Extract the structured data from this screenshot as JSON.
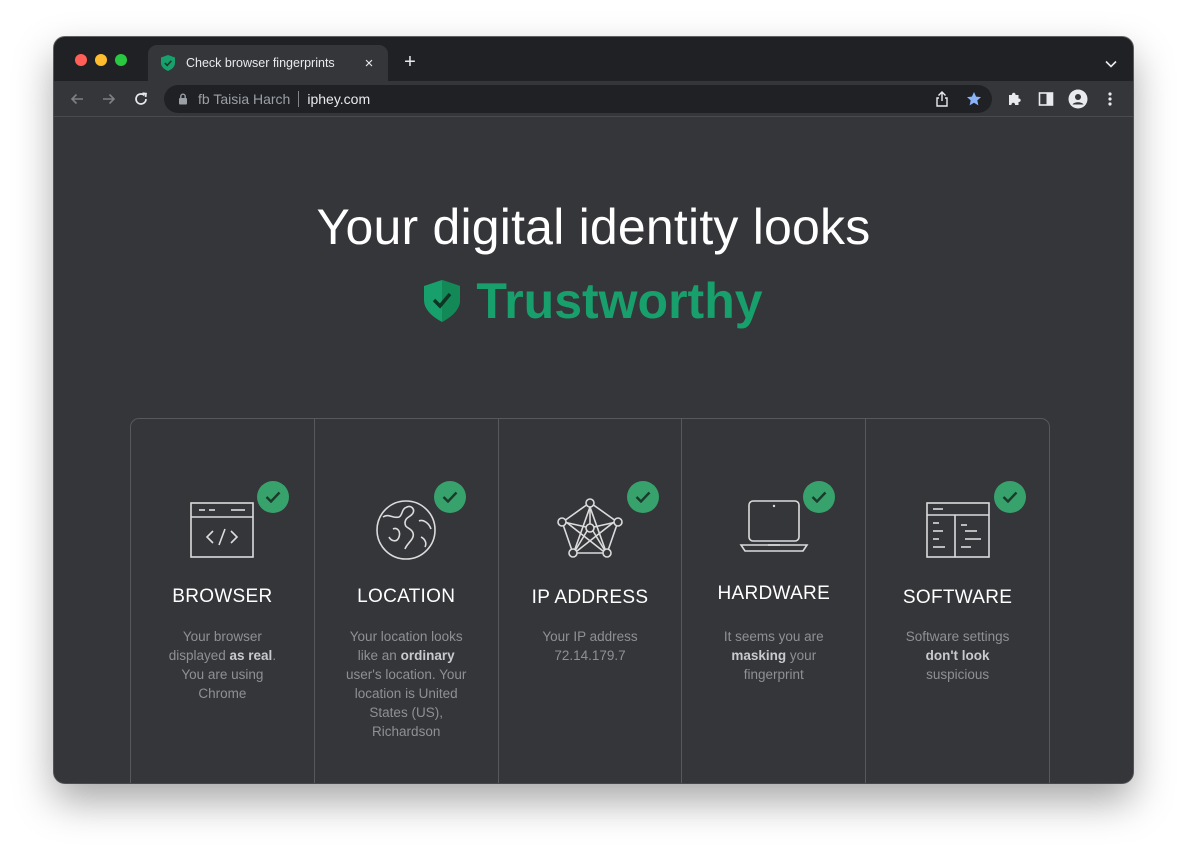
{
  "tab": {
    "title": "Check browser fingerprints",
    "close_glyph": "×",
    "new_tab_glyph": "+"
  },
  "omnibox": {
    "profile": "fb Taisia Harch",
    "url": "iphey.com"
  },
  "headline": "Your digital identity looks",
  "verdict": {
    "label": "Trustworthy",
    "color": "#17a06b"
  },
  "cards": [
    {
      "title": "BROWSER",
      "icon": "browser-code-icon",
      "desc_parts": [
        "Your browser displayed ",
        "as real",
        ". You are using Chrome"
      ]
    },
    {
      "title": "LOCATION",
      "icon": "globe-icon",
      "desc_parts": [
        "Your location looks like an ",
        "ordinary",
        " user's location. Your location is United States (US), Richardson"
      ]
    },
    {
      "title": "IP ADDRESS",
      "icon": "network-icon",
      "desc_parts": [
        "Your IP address 72.14.179.7",
        "",
        ""
      ]
    },
    {
      "title": "HARDWARE",
      "icon": "laptop-icon",
      "desc_parts": [
        "It seems you are ",
        "masking",
        " your fingerprint"
      ]
    },
    {
      "title": "SOFTWARE",
      "icon": "software-window-icon",
      "desc_parts": [
        "Software settings ",
        "don't look",
        " suspicious"
      ]
    }
  ],
  "colors": {
    "accent": "#17a06b",
    "badge": "#37a26b",
    "page_bg": "#35363a"
  }
}
